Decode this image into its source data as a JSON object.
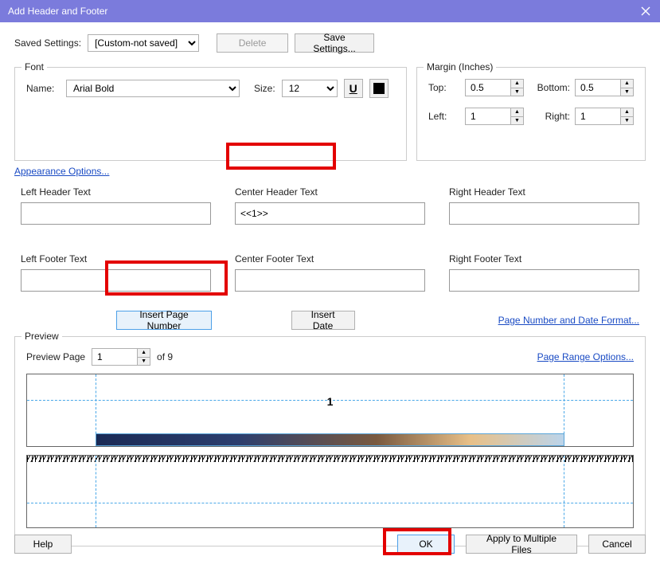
{
  "title": "Add Header and Footer",
  "saved": {
    "label": "Saved Settings:",
    "value": "[Custom-not saved]",
    "delete": "Delete",
    "save": "Save Settings..."
  },
  "font": {
    "legend": "Font",
    "name_label": "Name:",
    "name_value": "Arial Bold",
    "size_label": "Size:",
    "size_value": "12"
  },
  "appearance_link": "Appearance Options...",
  "margin": {
    "legend": "Margin (Inches)",
    "top_label": "Top:",
    "top": "0.5",
    "bottom_label": "Bottom:",
    "bottom": "0.5",
    "left_label": "Left:",
    "left": "1",
    "right_label": "Right:",
    "right": "1"
  },
  "hf": {
    "left_header_label": "Left Header Text",
    "left_header": "",
    "center_header_label": "Center Header Text",
    "center_header": "<<1>>",
    "right_header_label": "Right Header Text",
    "right_header": "",
    "left_footer_label": "Left Footer Text",
    "left_footer": "",
    "center_footer_label": "Center Footer Text",
    "center_footer": "",
    "right_footer_label": "Right Footer Text",
    "right_footer": ""
  },
  "insert_page": "Insert Page Number",
  "insert_date": "Insert Date",
  "format_link": "Page Number and Date Format...",
  "preview": {
    "legend": "Preview",
    "page_label": "Preview Page",
    "page_value": "1",
    "of_text": "of 9",
    "range_link": "Page Range Options...",
    "page_num_display": "1"
  },
  "buttons": {
    "help": "Help",
    "ok": "OK",
    "apply": "Apply to Multiple Files",
    "cancel": "Cancel"
  }
}
